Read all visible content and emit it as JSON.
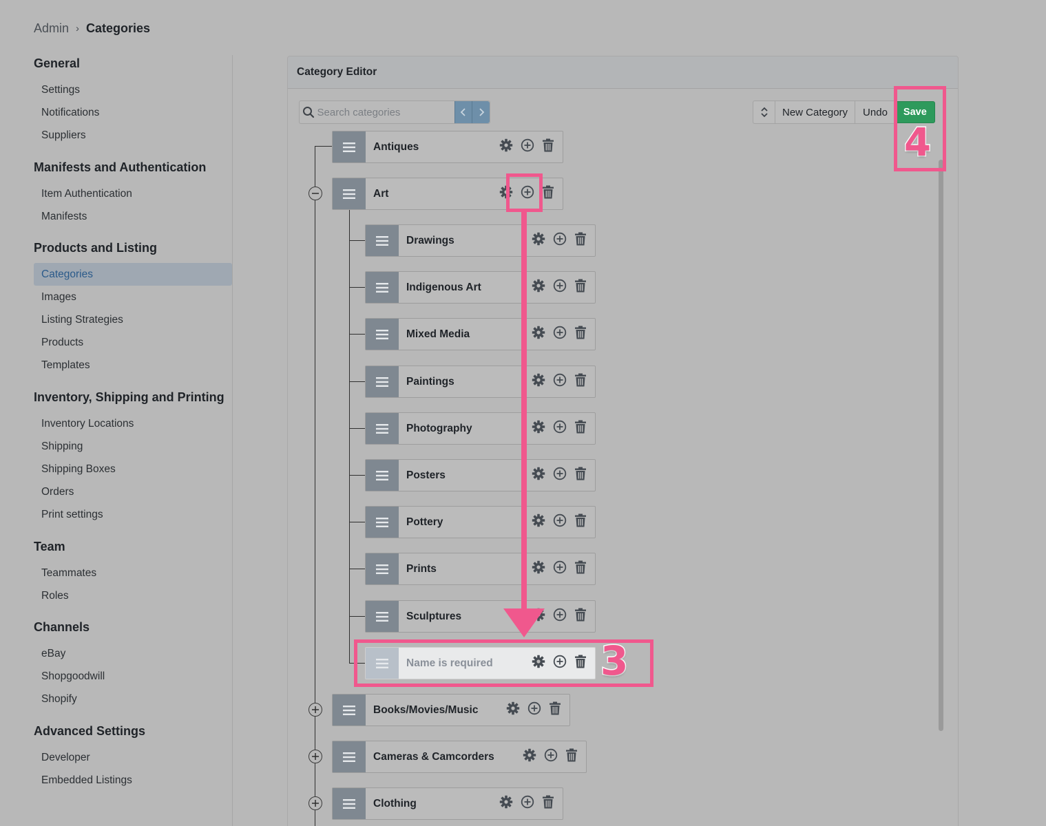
{
  "breadcrumb": {
    "root": "Admin",
    "separator": "›",
    "current": "Categories"
  },
  "sidebar": {
    "sections": [
      {
        "heading": "General",
        "items": [
          "Settings",
          "Notifications",
          "Suppliers"
        ]
      },
      {
        "heading": "Manifests and Authentication",
        "items": [
          "Item Authentication",
          "Manifests"
        ]
      },
      {
        "heading": "Products and Listing",
        "items": [
          "Categories",
          "Images",
          "Listing Strategies",
          "Products",
          "Templates"
        ]
      },
      {
        "heading": "Inventory, Shipping and Printing",
        "items": [
          "Inventory Locations",
          "Shipping",
          "Shipping Boxes",
          "Orders",
          "Print settings"
        ]
      },
      {
        "heading": "Team",
        "items": [
          "Teammates",
          "Roles"
        ]
      },
      {
        "heading": "Channels",
        "items": [
          "eBay",
          "Shopgoodwill",
          "Shopify"
        ]
      },
      {
        "heading": "Advanced Settings",
        "items": [
          "Developer",
          "Embedded Listings"
        ]
      }
    ],
    "active_item": "Categories"
  },
  "editor": {
    "title": "Category Editor",
    "search_placeholder": "Search categories",
    "toolbar": {
      "new_category_label": "New Category",
      "undo_label": "Undo",
      "save_label": "Save"
    },
    "colors": {
      "save": "#2e9a5c",
      "annotation": "#f0588d"
    },
    "tree": {
      "top_level": [
        "Antiques",
        "Art",
        "Books/Movies/Music",
        "Cameras & Camcorders",
        "Clothing"
      ],
      "art_children": [
        "Drawings",
        "Indigenous Art",
        "Mixed Media",
        "Paintings",
        "Photography",
        "Posters",
        "Pottery",
        "Prints",
        "Sculptures"
      ],
      "new_node_placeholder": "Name is required"
    }
  },
  "annotations": {
    "step3": "3",
    "step4": "4"
  }
}
